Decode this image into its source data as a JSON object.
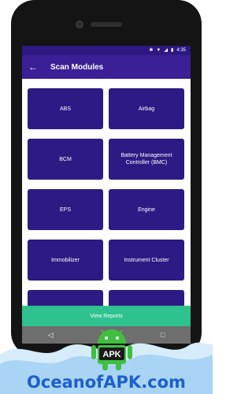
{
  "status_bar": {
    "time": "4:35",
    "icons": [
      "bluetooth-icon",
      "wifi-icon",
      "signal-icon",
      "battery-icon"
    ]
  },
  "app_bar": {
    "title": "Scan Modules",
    "back_icon": "arrow-left-icon"
  },
  "modules": [
    {
      "label": "ABS"
    },
    {
      "label": "Airbag"
    },
    {
      "label": "BCM"
    },
    {
      "label": "Battery Management Controller (BMC)"
    },
    {
      "label": "EPS"
    },
    {
      "label": "Engine"
    },
    {
      "label": "Immobilizer"
    },
    {
      "label": "Instrument Cluster"
    }
  ],
  "footer": {
    "report_button": "View Reports"
  },
  "nav": {
    "back": "◁",
    "home": "○",
    "recents": "□"
  },
  "colors": {
    "app_bar": "#3a1f96",
    "card": "#2e1a84",
    "report_bar": "#2ec28e"
  },
  "watermark": {
    "brand": "OceanofAPK.com",
    "badge": "APK"
  }
}
